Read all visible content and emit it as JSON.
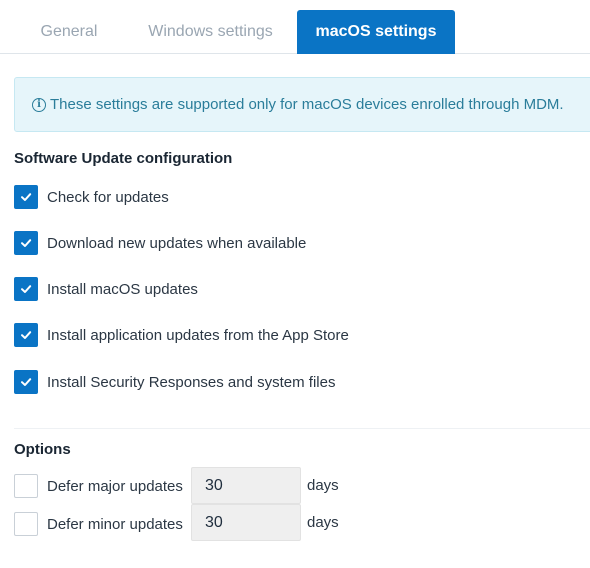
{
  "tabs": [
    {
      "label": "General",
      "active": false
    },
    {
      "label": "Windows settings",
      "active": false
    },
    {
      "label": "macOS settings",
      "active": true
    }
  ],
  "info_banner": {
    "icon": "info-circle-icon",
    "text": "These settings are supported only for macOS devices enrolled through MDM."
  },
  "software_update": {
    "title": "Software Update configuration",
    "items": [
      {
        "label": "Check for updates",
        "checked": true
      },
      {
        "label": "Download new updates when available",
        "checked": true
      },
      {
        "label": "Install macOS updates",
        "checked": true
      },
      {
        "label": "Install application updates from the App Store",
        "checked": true
      },
      {
        "label": "Install Security Responses and system files",
        "checked": true
      }
    ]
  },
  "options": {
    "title": "Options",
    "defer_major": {
      "label": "Defer major updates",
      "checked": false,
      "value": "30",
      "unit": "days"
    },
    "defer_minor": {
      "label": "Defer minor updates",
      "checked": false,
      "value": "30",
      "unit": "days"
    }
  },
  "colors": {
    "accent": "#0a74c5",
    "info_bg": "#e6f5fa",
    "info_text": "#2a7d9a"
  }
}
